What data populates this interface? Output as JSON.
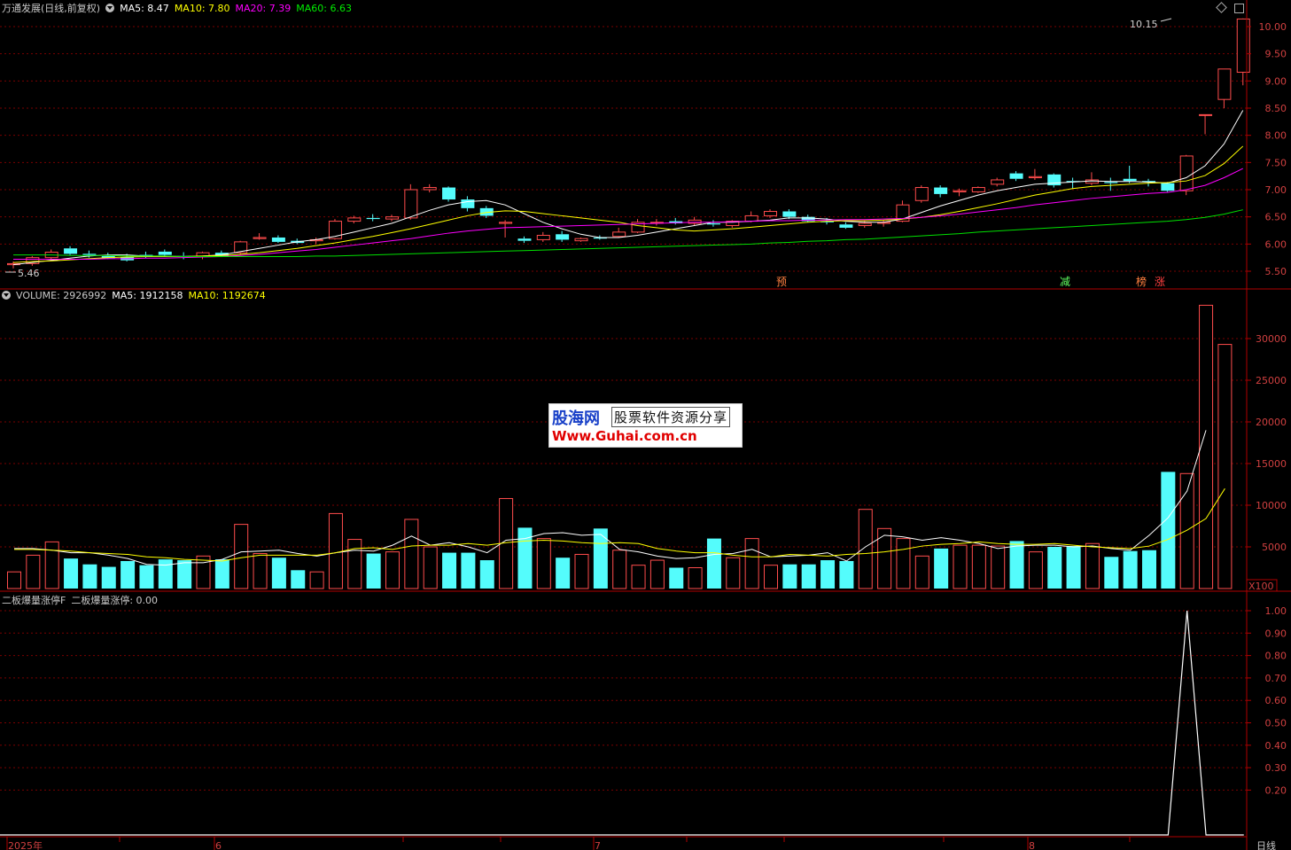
{
  "colors": {
    "up": "#ff4c4c",
    "down": "#54fcfc",
    "ma5": "#ffffff",
    "ma10": "#ffff00",
    "ma20": "#ff00ff",
    "ma60": "#00e000",
    "grid": "#7a0000",
    "axis": "#b00000"
  },
  "header": {
    "title": "万通发展(日线,前复权)",
    "ma5": "MA5: 8.47",
    "ma10": "MA10: 7.80",
    "ma20": "MA20: 7.39",
    "ma60": "MA60: 6.63"
  },
  "volume_header": {
    "label": "VOLUME: 2926992",
    "ma5": "MA5: 1912158",
    "ma10": "MA10: 1192674"
  },
  "indicator_header": {
    "name": "二板爆量涨停F",
    "value": "二板爆量涨停: 0.00"
  },
  "price_axis": {
    "ticks": [
      "10.00",
      "9.50",
      "9.00",
      "8.50",
      "8.00",
      "7.50",
      "7.00",
      "6.50",
      "6.00",
      "5.50"
    ],
    "high_label": "10.15",
    "low_label": "5.46"
  },
  "volume_axis": {
    "ticks": [
      "30000",
      "25000",
      "20000",
      "15000",
      "10000",
      "5000"
    ],
    "unit": "X100"
  },
  "indicator_axis": {
    "ticks": [
      "1.00",
      "0.90",
      "0.80",
      "0.70",
      "0.60",
      "0.50",
      "0.40",
      "0.30",
      "0.20"
    ]
  },
  "time_axis": {
    "labels": [
      "2025年",
      "6",
      "7",
      "8"
    ],
    "period": "日线"
  },
  "signals": [
    "预",
    "减",
    "榜",
    "涨"
  ],
  "watermark": {
    "title": "股海网",
    "subtitle": "股票软件资源分享",
    "url": "Www.Guhai.com.cn"
  },
  "chart_data": {
    "type": "candlestick",
    "candles": [
      {
        "o": 5.62,
        "h": 5.68,
        "l": 5.55,
        "c": 5.64
      },
      {
        "o": 5.64,
        "h": 5.78,
        "l": 5.6,
        "c": 5.75
      },
      {
        "o": 5.75,
        "h": 5.9,
        "l": 5.7,
        "c": 5.85
      },
      {
        "o": 5.92,
        "h": 5.96,
        "l": 5.8,
        "c": 5.82
      },
      {
        "o": 5.82,
        "h": 5.88,
        "l": 5.75,
        "c": 5.8
      },
      {
        "o": 5.78,
        "h": 5.84,
        "l": 5.72,
        "c": 5.74
      },
      {
        "o": 5.76,
        "h": 5.82,
        "l": 5.68,
        "c": 5.7
      },
      {
        "o": 5.8,
        "h": 5.86,
        "l": 5.74,
        "c": 5.78
      },
      {
        "o": 5.86,
        "h": 5.9,
        "l": 5.78,
        "c": 5.8
      },
      {
        "o": 5.78,
        "h": 5.85,
        "l": 5.72,
        "c": 5.77
      },
      {
        "o": 5.78,
        "h": 5.86,
        "l": 5.72,
        "c": 5.84
      },
      {
        "o": 5.84,
        "h": 5.88,
        "l": 5.76,
        "c": 5.78
      },
      {
        "o": 5.84,
        "h": 6.06,
        "l": 5.8,
        "c": 6.04
      },
      {
        "o": 6.1,
        "h": 6.2,
        "l": 6.08,
        "c": 6.12
      },
      {
        "o": 6.12,
        "h": 6.16,
        "l": 6.02,
        "c": 6.04
      },
      {
        "o": 6.06,
        "h": 6.1,
        "l": 6.0,
        "c": 6.02
      },
      {
        "o": 6.06,
        "h": 6.12,
        "l": 6.0,
        "c": 6.08
      },
      {
        "o": 6.1,
        "h": 6.46,
        "l": 6.08,
        "c": 6.42
      },
      {
        "o": 6.42,
        "h": 6.52,
        "l": 6.38,
        "c": 6.48
      },
      {
        "o": 6.48,
        "h": 6.55,
        "l": 6.42,
        "c": 6.46
      },
      {
        "o": 6.46,
        "h": 6.54,
        "l": 6.42,
        "c": 6.5
      },
      {
        "o": 6.48,
        "h": 7.1,
        "l": 6.45,
        "c": 7.0
      },
      {
        "o": 7.0,
        "h": 7.1,
        "l": 6.95,
        "c": 7.04
      },
      {
        "o": 7.04,
        "h": 7.06,
        "l": 6.78,
        "c": 6.82
      },
      {
        "o": 6.82,
        "h": 6.88,
        "l": 6.6,
        "c": 6.66
      },
      {
        "o": 6.66,
        "h": 6.7,
        "l": 6.48,
        "c": 6.52
      },
      {
        "o": 6.38,
        "h": 6.44,
        "l": 6.12,
        "c": 6.4
      },
      {
        "o": 6.1,
        "h": 6.14,
        "l": 6.02,
        "c": 6.06
      },
      {
        "o": 6.08,
        "h": 6.22,
        "l": 6.04,
        "c": 6.16
      },
      {
        "o": 6.18,
        "h": 6.24,
        "l": 6.04,
        "c": 6.08
      },
      {
        "o": 6.06,
        "h": 6.12,
        "l": 6.04,
        "c": 6.1
      },
      {
        "o": 6.12,
        "h": 6.16,
        "l": 6.08,
        "c": 6.1
      },
      {
        "o": 6.14,
        "h": 6.3,
        "l": 6.12,
        "c": 6.22
      },
      {
        "o": 6.22,
        "h": 6.46,
        "l": 6.2,
        "c": 6.4
      },
      {
        "o": 6.4,
        "h": 6.46,
        "l": 6.34,
        "c": 6.4
      },
      {
        "o": 6.42,
        "h": 6.48,
        "l": 6.36,
        "c": 6.38
      },
      {
        "o": 6.38,
        "h": 6.5,
        "l": 6.34,
        "c": 6.44
      },
      {
        "o": 6.38,
        "h": 6.44,
        "l": 6.32,
        "c": 6.36
      },
      {
        "o": 6.34,
        "h": 6.44,
        "l": 6.3,
        "c": 6.42
      },
      {
        "o": 6.42,
        "h": 6.6,
        "l": 6.4,
        "c": 6.52
      },
      {
        "o": 6.52,
        "h": 6.64,
        "l": 6.48,
        "c": 6.6
      },
      {
        "o": 6.6,
        "h": 6.64,
        "l": 6.46,
        "c": 6.5
      },
      {
        "o": 6.5,
        "h": 6.54,
        "l": 6.4,
        "c": 6.42
      },
      {
        "o": 6.42,
        "h": 6.48,
        "l": 6.36,
        "c": 6.4
      },
      {
        "o": 6.36,
        "h": 6.4,
        "l": 6.28,
        "c": 6.3
      },
      {
        "o": 6.34,
        "h": 6.42,
        "l": 6.3,
        "c": 6.38
      },
      {
        "o": 6.38,
        "h": 6.44,
        "l": 6.32,
        "c": 6.4
      },
      {
        "o": 6.42,
        "h": 6.8,
        "l": 6.4,
        "c": 6.72
      },
      {
        "o": 6.8,
        "h": 7.08,
        "l": 6.76,
        "c": 7.04
      },
      {
        "o": 7.04,
        "h": 7.08,
        "l": 6.86,
        "c": 6.92
      },
      {
        "o": 6.96,
        "h": 7.02,
        "l": 6.88,
        "c": 6.98
      },
      {
        "o": 6.96,
        "h": 7.06,
        "l": 6.94,
        "c": 7.04
      },
      {
        "o": 7.1,
        "h": 7.22,
        "l": 7.06,
        "c": 7.18
      },
      {
        "o": 7.3,
        "h": 7.34,
        "l": 7.16,
        "c": 7.2
      },
      {
        "o": 7.22,
        "h": 7.38,
        "l": 7.18,
        "c": 7.24
      },
      {
        "o": 7.28,
        "h": 7.3,
        "l": 7.04,
        "c": 7.08
      },
      {
        "o": 7.16,
        "h": 7.22,
        "l": 7.02,
        "c": 7.14
      },
      {
        "o": 7.12,
        "h": 7.32,
        "l": 7.08,
        "c": 7.18
      },
      {
        "o": 7.14,
        "h": 7.22,
        "l": 6.98,
        "c": 7.12
      },
      {
        "o": 7.2,
        "h": 7.44,
        "l": 7.12,
        "c": 7.16
      },
      {
        "o": 7.16,
        "h": 7.2,
        "l": 7.06,
        "c": 7.14
      },
      {
        "o": 7.12,
        "h": 7.14,
        "l": 6.96,
        "c": 6.98
      },
      {
        "o": 6.98,
        "h": 7.64,
        "l": 6.9,
        "c": 7.62
      },
      {
        "o": 8.38,
        "h": 8.38,
        "l": 8.02,
        "c": 8.38
      },
      {
        "o": 8.66,
        "h": 9.22,
        "l": 8.5,
        "c": 9.22
      },
      {
        "o": 9.16,
        "h": 10.15,
        "l": 8.92,
        "c": 10.14
      }
    ],
    "ma5": [
      5.62,
      5.66,
      5.7,
      5.74,
      5.78,
      5.8,
      5.8,
      5.78,
      5.78,
      5.77,
      5.78,
      5.8,
      5.86,
      5.92,
      5.98,
      6.04,
      6.08,
      6.14,
      6.22,
      6.3,
      6.38,
      6.5,
      6.62,
      6.72,
      6.78,
      6.8,
      6.72,
      6.56,
      6.4,
      6.28,
      6.18,
      6.12,
      6.12,
      6.16,
      6.22,
      6.28,
      6.34,
      6.4,
      6.4,
      6.42,
      6.44,
      6.48,
      6.48,
      6.46,
      6.42,
      6.4,
      6.4,
      6.46,
      6.58,
      6.7,
      6.8,
      6.9,
      6.98,
      7.04,
      7.1,
      7.12,
      7.14,
      7.16,
      7.15,
      7.15,
      7.14,
      7.12,
      7.22,
      7.44,
      7.84,
      8.46
    ],
    "ma10": [
      5.66,
      5.68,
      5.69,
      5.71,
      5.73,
      5.75,
      5.76,
      5.77,
      5.77,
      5.77,
      5.78,
      5.79,
      5.81,
      5.84,
      5.88,
      5.92,
      5.97,
      6.02,
      6.08,
      6.14,
      6.21,
      6.28,
      6.36,
      6.44,
      6.52,
      6.58,
      6.61,
      6.6,
      6.56,
      6.52,
      6.48,
      6.44,
      6.4,
      6.34,
      6.3,
      6.26,
      6.24,
      6.26,
      6.28,
      6.31,
      6.34,
      6.37,
      6.4,
      6.42,
      6.43,
      6.43,
      6.44,
      6.46,
      6.49,
      6.54,
      6.6,
      6.67,
      6.74,
      6.82,
      6.9,
      6.96,
      7.02,
      7.06,
      7.08,
      7.1,
      7.12,
      7.13,
      7.16,
      7.26,
      7.48,
      7.8
    ],
    "ma20": [
      5.72,
      5.72,
      5.72,
      5.72,
      5.72,
      5.73,
      5.73,
      5.74,
      5.74,
      5.75,
      5.76,
      5.77,
      5.79,
      5.81,
      5.84,
      5.87,
      5.9,
      5.94,
      5.98,
      6.02,
      6.06,
      6.1,
      6.15,
      6.2,
      6.24,
      6.27,
      6.3,
      6.31,
      6.32,
      6.33,
      6.34,
      6.35,
      6.36,
      6.37,
      6.38,
      6.39,
      6.4,
      6.4,
      6.41,
      6.42,
      6.43,
      6.43,
      6.44,
      6.44,
      6.45,
      6.45,
      6.46,
      6.47,
      6.49,
      6.52,
      6.55,
      6.59,
      6.63,
      6.67,
      6.72,
      6.76,
      6.8,
      6.84,
      6.87,
      6.9,
      6.93,
      6.95,
      7.0,
      7.08,
      7.22,
      7.39
    ],
    "ma60": [
      5.8,
      5.8,
      5.8,
      5.79,
      5.79,
      5.79,
      5.78,
      5.78,
      5.78,
      5.77,
      5.77,
      5.77,
      5.77,
      5.77,
      5.77,
      5.77,
      5.78,
      5.78,
      5.79,
      5.8,
      5.81,
      5.82,
      5.83,
      5.84,
      5.85,
      5.86,
      5.87,
      5.88,
      5.89,
      5.9,
      5.91,
      5.92,
      5.93,
      5.94,
      5.95,
      5.96,
      5.97,
      5.98,
      5.99,
      6.0,
      6.02,
      6.03,
      6.05,
      6.06,
      6.08,
      6.09,
      6.11,
      6.13,
      6.15,
      6.17,
      6.19,
      6.22,
      6.24,
      6.26,
      6.28,
      6.3,
      6.32,
      6.34,
      6.36,
      6.38,
      6.4,
      6.42,
      6.45,
      6.49,
      6.55,
      6.63
    ],
    "volume": [
      2000,
      4000,
      5600,
      3600,
      2900,
      2600,
      3300,
      2800,
      3500,
      3400,
      3900,
      3500,
      7700,
      4200,
      3700,
      2200,
      2000,
      9000,
      5900,
      4200,
      4400,
      8300,
      5000,
      4300,
      4300,
      3400,
      10800,
      7300,
      6000,
      3700,
      4100,
      7200,
      4600,
      2800,
      3400,
      2500,
      2500,
      6000,
      3700,
      6000,
      2800,
      2900,
      2900,
      3400,
      3300,
      9500,
      7200,
      6000,
      3900,
      4800,
      5200,
      5200,
      5100,
      5700,
      4400,
      5000,
      5100,
      5400,
      3800,
      4500,
      4600,
      14000,
      13800,
      34000,
      29300
    ],
    "vol_ma5": [
      4800,
      4800,
      4600,
      4300,
      4300,
      4000,
      3600,
      2900,
      2800,
      3100,
      3100,
      3500,
      4400,
      4500,
      4600,
      4200,
      3900,
      4300,
      4600,
      4500,
      5200,
      6300,
      5200,
      5500,
      5000,
      4300,
      5800,
      6000,
      6600,
      6700,
      6400,
      6500,
      4700,
      4400,
      3900,
      3600,
      3700,
      4100,
      4200,
      4700,
      3800,
      3900,
      4000,
      4300,
      3300,
      5000,
      6400,
      6200,
      5800,
      6100,
      5800,
      5400,
      4800,
      5100,
      5200,
      5200,
      5000,
      5100,
      4800,
      4600,
      6400,
      8500,
      11700,
      19000
    ],
    "vol_ma10": [
      4700,
      4700,
      4600,
      4500,
      4300,
      4200,
      4100,
      3800,
      3700,
      3500,
      3400,
      3300,
      3700,
      4000,
      4000,
      4000,
      4000,
      4300,
      4800,
      4900,
      4700,
      5100,
      5200,
      5200,
      5400,
      5200,
      5500,
      5700,
      5800,
      5700,
      5500,
      5400,
      5500,
      5400,
      4800,
      4500,
      4300,
      4300,
      4000,
      3800,
      3800,
      4100,
      4000,
      3900,
      4100,
      4200,
      4400,
      4700,
      5100,
      5300,
      5400,
      5600,
      5400,
      5300,
      5300,
      5400,
      5200,
      5000,
      4900,
      4800,
      5100,
      5900,
      7000,
      8400,
      12000
    ],
    "indicator": {
      "name": "二板爆量涨停",
      "spike_index": 62,
      "value": 1.0
    }
  }
}
